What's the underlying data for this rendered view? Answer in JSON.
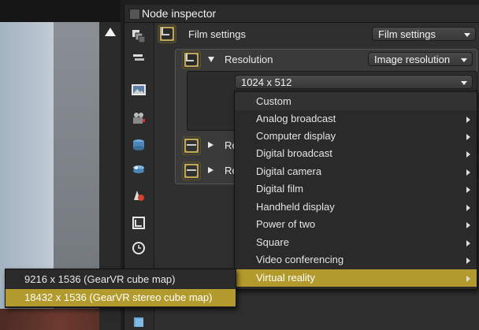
{
  "panel": {
    "title": "Node inspector"
  },
  "film": {
    "label": "Film settings",
    "select_value": "Film settings"
  },
  "resolution": {
    "label": "Resolution",
    "select_value": "Image resolution",
    "value": "1024 x 512"
  },
  "collapsed_rows": [
    {
      "label": "Re"
    },
    {
      "label": "Re"
    }
  ],
  "menu": {
    "items": [
      {
        "label": "Custom",
        "has_submenu": false
      },
      {
        "label": "Analog broadcast",
        "has_submenu": true
      },
      {
        "label": "Computer display",
        "has_submenu": true
      },
      {
        "label": "Digital broadcast",
        "has_submenu": true
      },
      {
        "label": "Digital camera",
        "has_submenu": true
      },
      {
        "label": "Digital film",
        "has_submenu": true
      },
      {
        "label": "Handheld display",
        "has_submenu": true
      },
      {
        "label": "Power of two",
        "has_submenu": true
      },
      {
        "label": "Square",
        "has_submenu": true
      },
      {
        "label": "Video conferencing",
        "has_submenu": true
      },
      {
        "label": "Virtual reality",
        "has_submenu": true,
        "active": true
      }
    ]
  },
  "submenu": {
    "items": [
      {
        "label": "9216 x 1536  (GearVR cube map)"
      },
      {
        "label": "18432 x 1536 (GearVR stereo cube map)",
        "active": true
      }
    ]
  },
  "toolbar_icons": [
    "node-graph-icon",
    "layers-icon",
    "image-icon",
    "camera-icon",
    "mesh-icon",
    "texture-icon",
    "material-icon",
    "film-icon",
    "clock-icon"
  ],
  "colors": {
    "accent": "#b39a2c",
    "panel": "#323232",
    "menu": "#2a2a2a"
  }
}
